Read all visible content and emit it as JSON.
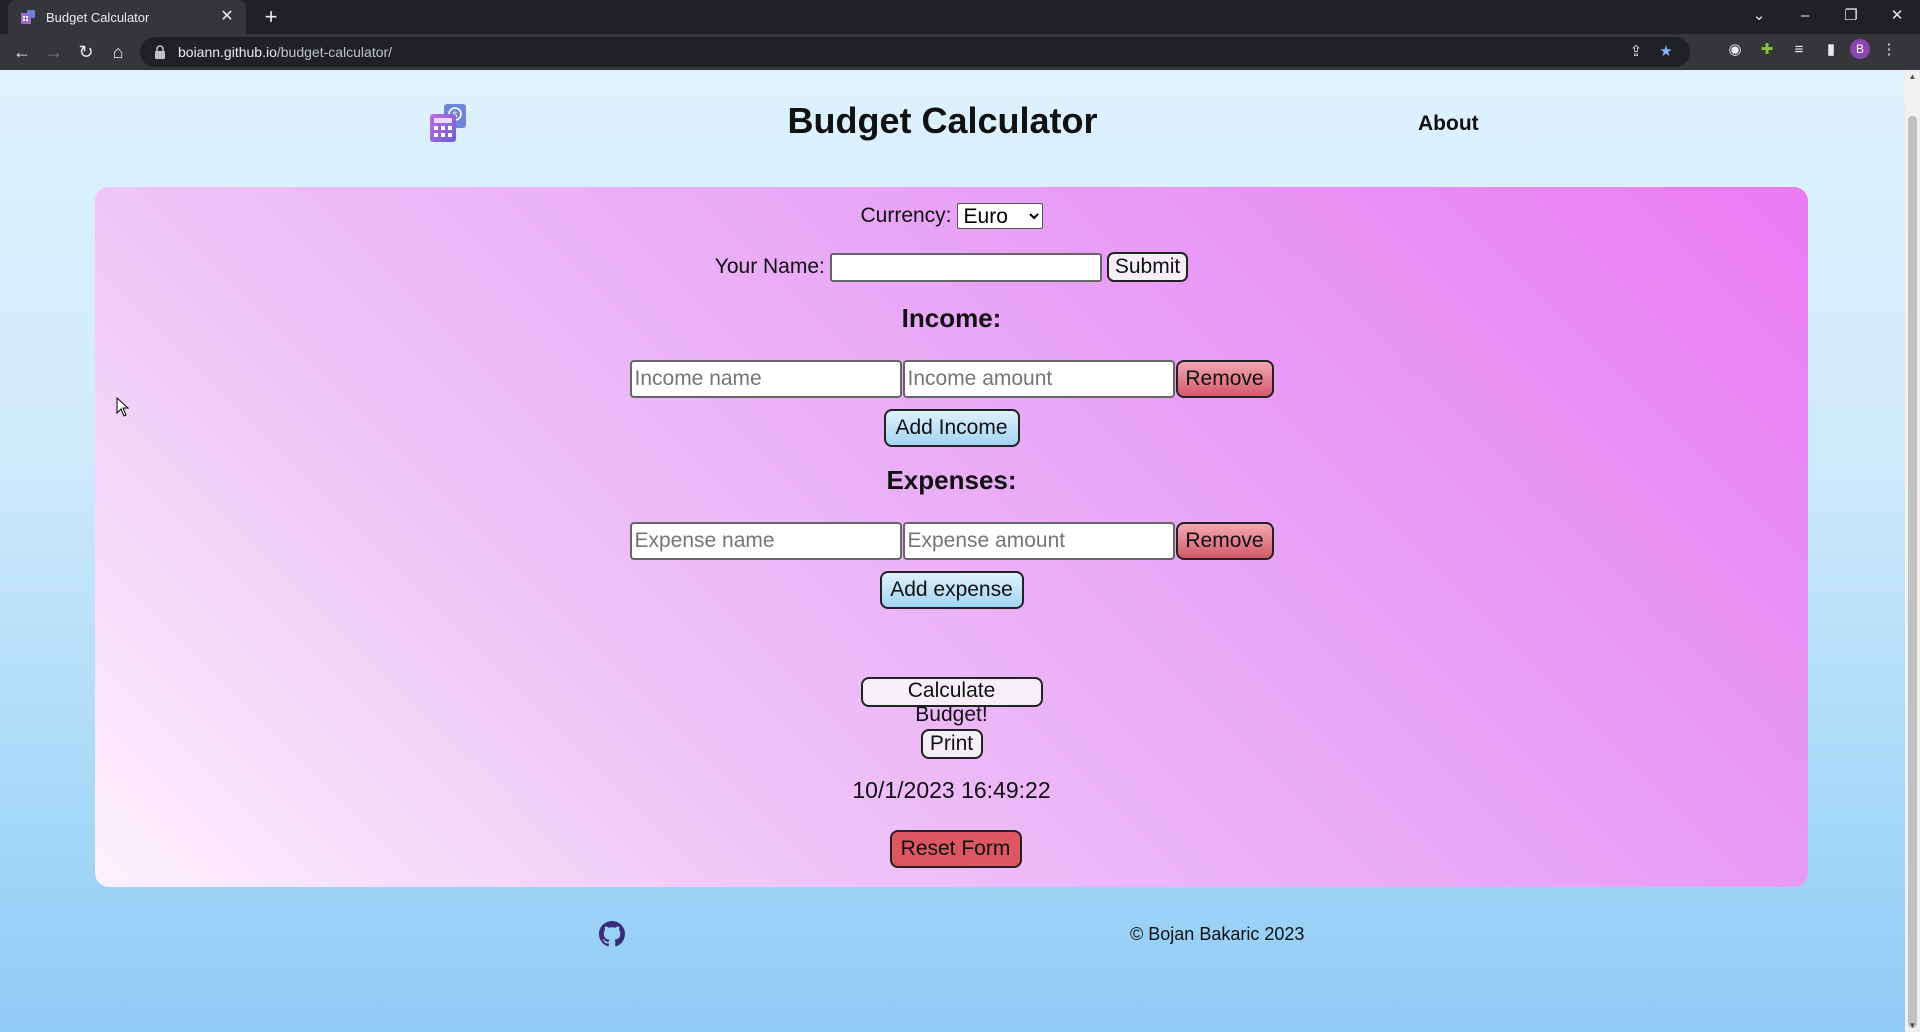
{
  "browser": {
    "tab_title": "Budget Calculator",
    "url_host": "boiann.github.io",
    "url_path": "/budget-calculator/"
  },
  "header": {
    "title": "Budget Calculator",
    "about_label": "About"
  },
  "form": {
    "currency_label": "Currency:",
    "currency_selected": "Euro",
    "name_label": "Your Name:",
    "name_value": "",
    "submit_label": "Submit",
    "income_heading": "Income:",
    "income_name_placeholder": "Income name",
    "income_amount_placeholder": "Income amount",
    "remove_label": "Remove",
    "add_income_label": "Add Income",
    "expenses_heading": "Expenses:",
    "expense_name_placeholder": "Expense name",
    "expense_amount_placeholder": "Expense amount",
    "add_expense_label": "Add expense",
    "calculate_label": "Calculate Budget!",
    "print_label": "Print",
    "datetime": "10/1/2023 16:49:22",
    "reset_label": "Reset Form"
  },
  "footer": {
    "copyright": "Bojan Bakaric 2023"
  },
  "colors": {
    "card_accent": "#ea7af4",
    "remove_button": "#d35a6a",
    "reset_button": "#dc5761",
    "blue_button": "#a2d4f4"
  }
}
